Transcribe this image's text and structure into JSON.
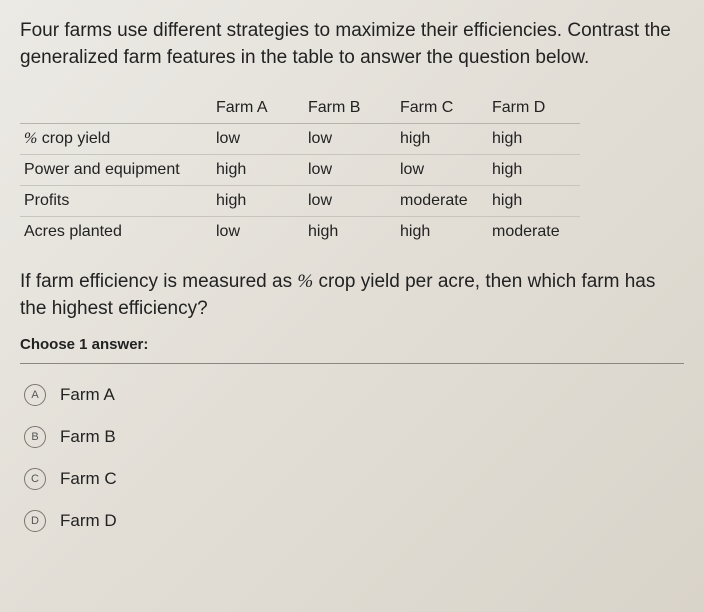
{
  "intro": "Four farms use different strategies to maximize their efficiencies. Contrast the generalized farm features in the table to answer the question below.",
  "table": {
    "headers": [
      "",
      "Farm A",
      "Farm B",
      "Farm C",
      "Farm D"
    ],
    "rows": [
      {
        "label_prefix": "%",
        "label": " crop yield",
        "cells": [
          "low",
          "low",
          "high",
          "high"
        ]
      },
      {
        "label_prefix": "",
        "label": "Power and equipment",
        "cells": [
          "high",
          "low",
          "low",
          "high"
        ]
      },
      {
        "label_prefix": "",
        "label": "Profits",
        "cells": [
          "high",
          "low",
          "moderate",
          "high"
        ]
      },
      {
        "label_prefix": "",
        "label": "Acres planted",
        "cells": [
          "low",
          "high",
          "high",
          "moderate"
        ]
      }
    ]
  },
  "question_pre": "If farm efficiency is measured as ",
  "question_pct": "%",
  "question_post": " crop yield per acre, then which farm has the highest efficiency?",
  "choose": "Choose 1 answer:",
  "options": [
    {
      "letter": "A",
      "text": "Farm A"
    },
    {
      "letter": "B",
      "text": "Farm B"
    },
    {
      "letter": "C",
      "text": "Farm C"
    },
    {
      "letter": "D",
      "text": "Farm D"
    }
  ]
}
